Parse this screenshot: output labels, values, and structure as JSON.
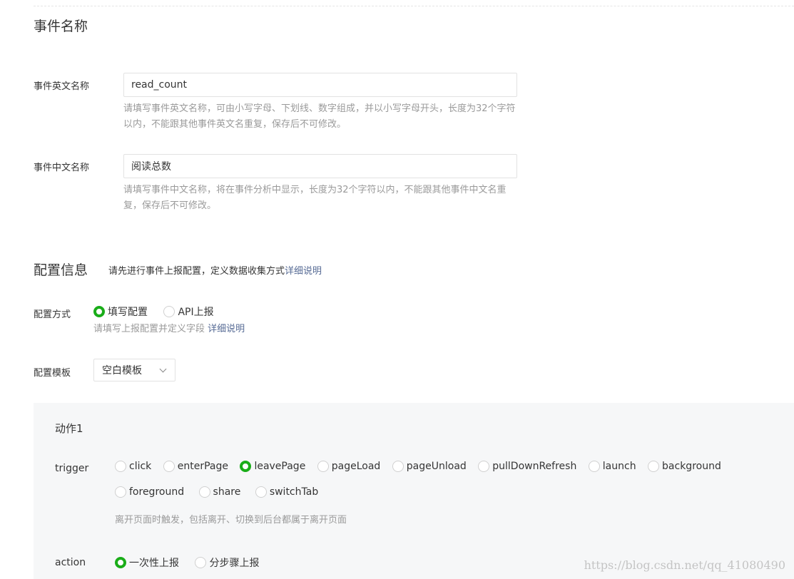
{
  "event_name_section": {
    "title": "事件名称",
    "english_name": {
      "label": "事件英文名称",
      "value": "read_count",
      "hint": "请填写事件英文名称，可由小写字母、下划线、数字组成，并以小写字母开头，长度为32个字符以内，不能跟其他事件英文名重复，保存后不可修改。"
    },
    "chinese_name": {
      "label": "事件中文名称",
      "value": "阅读总数",
      "hint": "请填写事件中文名称，将在事件分析中显示，长度为32个字符以内，不能跟其他事件中文名重复，保存后不可修改。"
    }
  },
  "config_section": {
    "title": "配置信息",
    "description": "请先进行事件上报配置，定义数据收集方式",
    "description_link": "详细说明",
    "method": {
      "label": "配置方式",
      "options": [
        {
          "label": "填写配置",
          "checked": true
        },
        {
          "label": "API上报",
          "checked": false
        }
      ],
      "hint": "请填写上报配置并定义字段",
      "hint_link": "详细说明"
    },
    "template": {
      "label": "配置模板",
      "selected": "空白模板"
    }
  },
  "action_panel": {
    "title": "动作1",
    "trigger": {
      "label": "trigger",
      "options_row1": [
        {
          "label": "click",
          "checked": false
        },
        {
          "label": "enterPage",
          "checked": false
        },
        {
          "label": "leavePage",
          "checked": true
        },
        {
          "label": "pageLoad",
          "checked": false
        },
        {
          "label": "pageUnload",
          "checked": false
        },
        {
          "label": "pullDownRefresh",
          "checked": false
        },
        {
          "label": "launch",
          "checked": false
        },
        {
          "label": "background",
          "checked": false
        }
      ],
      "options_row2": [
        {
          "label": "foreground",
          "checked": false
        },
        {
          "label": "share",
          "checked": false
        },
        {
          "label": "switchTab",
          "checked": false
        }
      ],
      "hint": "离开页面时触发，包括离开、切换到后台都属于离开页面"
    },
    "action": {
      "label": "action",
      "options": [
        {
          "label": "一次性上报",
          "checked": true
        },
        {
          "label": "分步骤上报",
          "checked": false
        }
      ]
    }
  },
  "watermark": "https://blog.csdn.net/qq_41080490",
  "colors": {
    "accent_green": "#1aad19",
    "link_blue": "#576b95",
    "hint_gray": "#9a9a9a",
    "panel_bg": "#f6f7f8"
  }
}
